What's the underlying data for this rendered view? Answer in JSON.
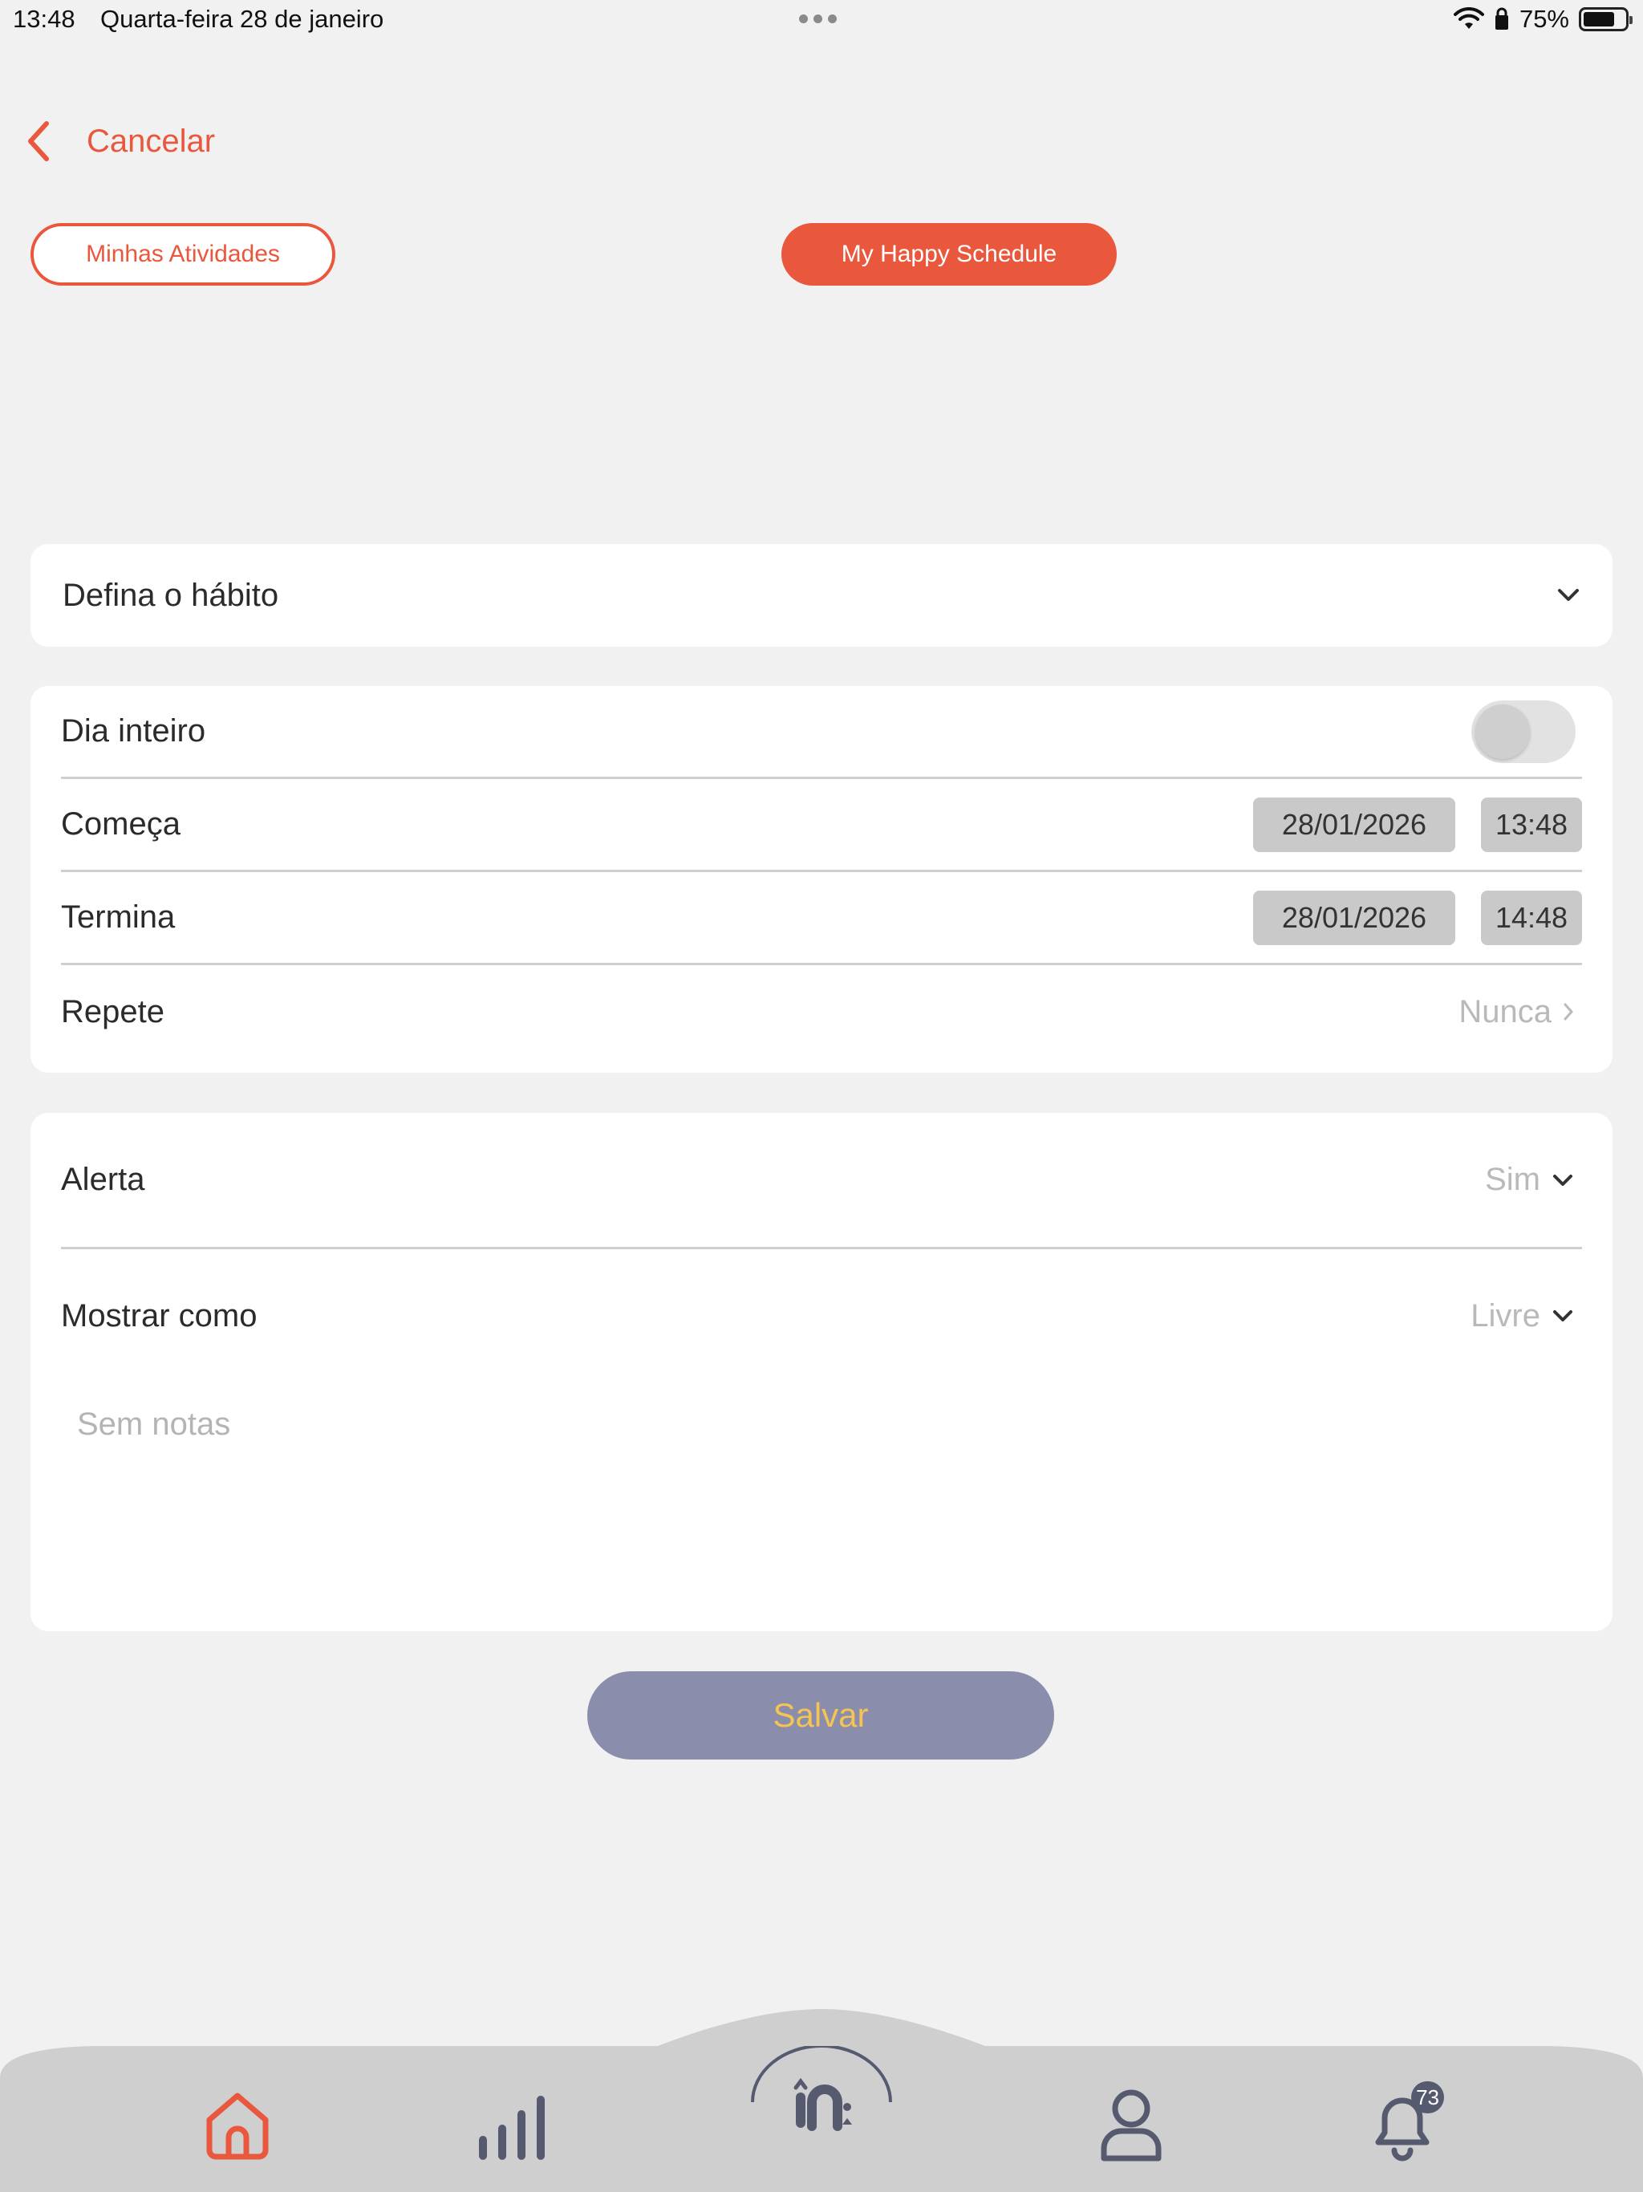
{
  "status_bar": {
    "time": "13:48",
    "date": "Quarta-feira 28 de janeiro",
    "battery": "75%",
    "battery_level": 0.75
  },
  "header": {
    "cancel_label": "Cancelar"
  },
  "tabs": {
    "my_activities": "Minhas Atividades",
    "happy_schedule": "My Happy Schedule"
  },
  "habit": {
    "label": "Defina o hábito"
  },
  "schedule": {
    "all_day_label": "Dia inteiro",
    "all_day_on": false,
    "starts_label": "Começa",
    "starts_date": "28/01/2026",
    "starts_time": "13:48",
    "ends_label": "Termina",
    "ends_date": "28/01/2026",
    "ends_time": "14:48",
    "repeat_label": "Repete",
    "repeat_value": "Nunca"
  },
  "alert": {
    "alert_label": "Alerta",
    "alert_value": "Sim",
    "show_as_label": "Mostrar como",
    "show_as_value": "Livre",
    "notes_placeholder": "Sem notas"
  },
  "actions": {
    "save_label": "Salvar"
  },
  "nav": {
    "notifications_count": "73"
  },
  "colors": {
    "accent": "#e9573d",
    "save_bg": "#8a8eac",
    "save_text": "#f5c451",
    "nav_bg": "#cfcfcf",
    "nav_icon": "#555a6e"
  }
}
